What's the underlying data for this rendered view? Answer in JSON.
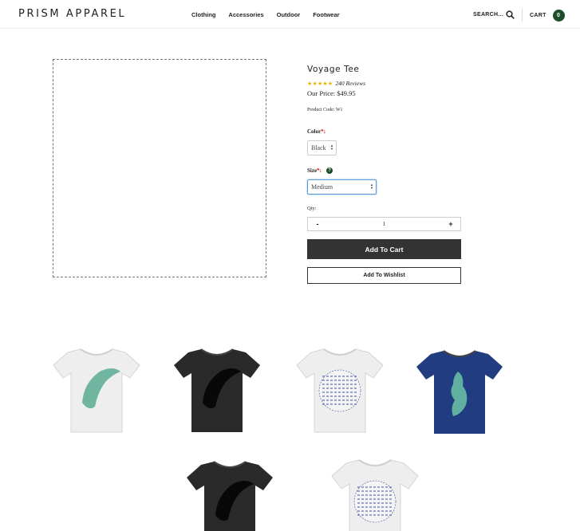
{
  "header": {
    "logo": "PRISM APPAREL",
    "nav": [
      "Clothing",
      "Accessories",
      "Outdoor",
      "Footwear"
    ],
    "search_label": "SEARCH...",
    "cart_label": "CART",
    "cart_count": "0",
    "colors": {
      "accent": "#1e4d2b"
    }
  },
  "product": {
    "title": "Voyage Tee",
    "stars": "★★★★★",
    "reviews": "240 Reviews",
    "price": "Our Price: $49.95",
    "code": "Product Code: W1",
    "color_label": "Color",
    "color_value": "Black",
    "size_label": "Size",
    "size_value": "Medium",
    "qty_label": "Qty:",
    "qty_minus": "-",
    "qty_value": "1",
    "qty_plus": "+",
    "add_to_cart": "Add To Cart",
    "add_to_wishlist": "Add To Wishlist",
    "required_mark": "*:",
    "help_icon": "?"
  },
  "thumbnails": [
    {
      "shirt": "#eeeeee",
      "print": "teal-brush",
      "print_color": "#6fb5a0"
    },
    {
      "shirt": "#2a2a2a",
      "print": "black-brush",
      "print_color": "#080808"
    },
    {
      "shirt": "#eeeeee",
      "print": "blue-pattern",
      "print_color": "#3b4fa0"
    },
    {
      "shirt": "#213c80",
      "print": "teal-figure",
      "print_color": "#5fb0a0"
    },
    {
      "shirt": "#2a2a2a",
      "print": "black-brush",
      "print_color": "#080808"
    },
    {
      "shirt": "#eeeeee",
      "print": "blue-pattern",
      "print_color": "#3b4fa0"
    }
  ]
}
